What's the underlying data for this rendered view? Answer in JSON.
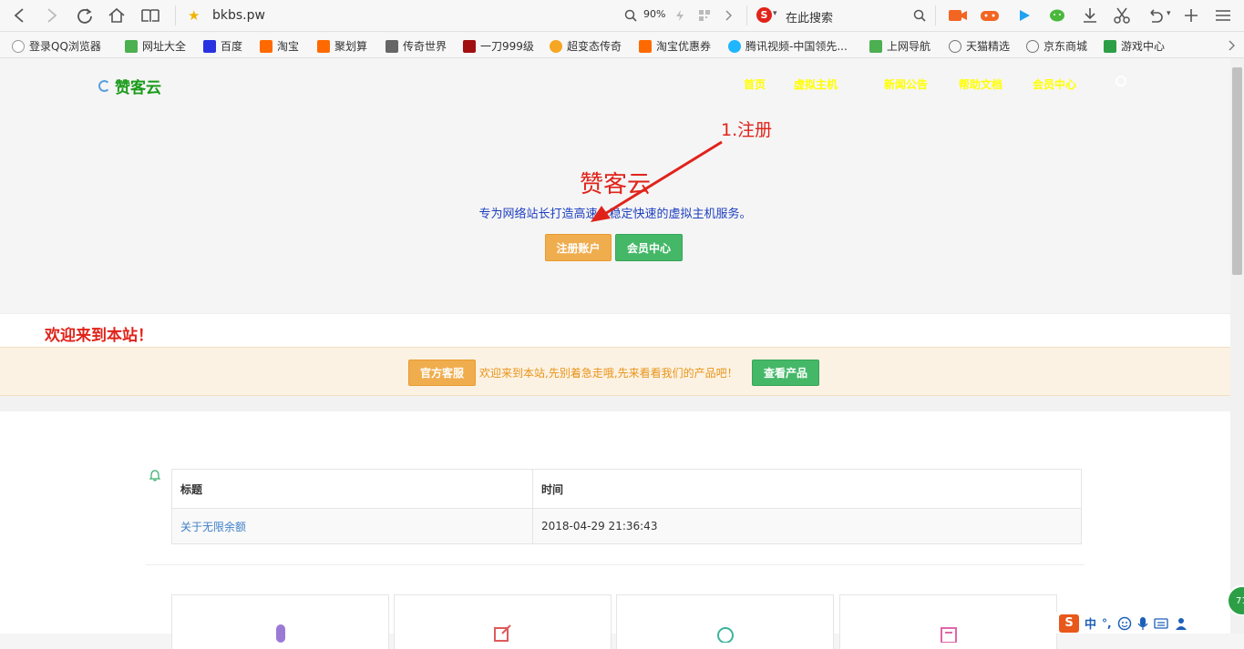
{
  "browser": {
    "address": "bkbs.pw",
    "zoom": "90%",
    "search_placeholder": "在此搜索"
  },
  "bookmarks": [
    {
      "label": "登录QQ浏览器",
      "color": "#ffffff"
    },
    {
      "label": "网址大全",
      "color": "#4caf50"
    },
    {
      "label": "百度",
      "color": "#2932e1"
    },
    {
      "label": "淘宝",
      "color": "#ff6a00"
    },
    {
      "label": "聚划算",
      "color": "#ff6a00"
    },
    {
      "label": "传奇世界",
      "color": "#555555"
    },
    {
      "label": "一刀999级",
      "color": "#a01010"
    },
    {
      "label": "超变态传奇",
      "color": "#f5a623"
    },
    {
      "label": "淘宝优惠券",
      "color": "#ff6a00"
    },
    {
      "label": "腾讯视频-中国领先...",
      "color": "#1fb6ff"
    },
    {
      "label": "上网导航",
      "color": "#4caf50"
    },
    {
      "label": "天猫精选",
      "color": "#777777"
    },
    {
      "label": "京东商城",
      "color": "#777777"
    },
    {
      "label": "游戏中心",
      "color": "#2c9f46"
    }
  ],
  "site": {
    "logo": "赞客云",
    "nav": [
      "首页",
      "虚拟主机",
      "新闻公告",
      "帮助文档",
      "会员中心"
    ],
    "hero_title": "赞客云",
    "hero_subtitle": "专为网络站长打造高速、稳定快速的虚拟主机服务。",
    "register_button": "注册账户",
    "member_button": "会员中心",
    "annotation": "1.注册",
    "welcome": "欢迎来到本站！",
    "service_button": "官方客服",
    "notice_text": "欢迎来到本站,先别着急走哦,先来看看我们的产品吧！",
    "products_button": "查看产品",
    "table": {
      "headers": [
        "标题",
        "时间"
      ],
      "rows": [
        {
          "title": "关于无限余额",
          "time": "2018-04-29 21:36:43"
        }
      ]
    }
  },
  "ime": {
    "label": "中",
    "badge": "71"
  },
  "colors": {
    "accent_orange": "#f0ad4e",
    "accent_green": "#45b868",
    "annotation_red": "#e0231a"
  }
}
